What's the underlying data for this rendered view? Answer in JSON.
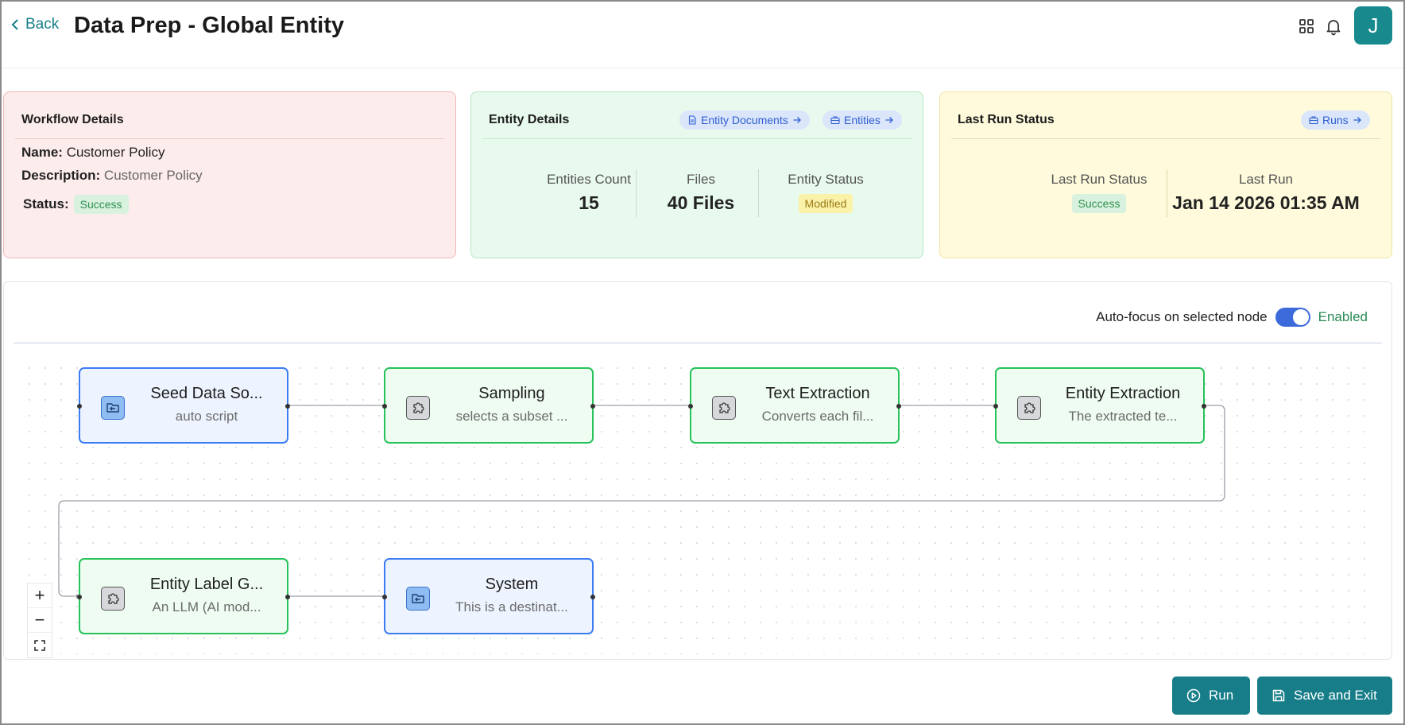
{
  "header": {
    "back_label": "Back",
    "title": "Data Prep - Global Entity",
    "avatar_initial": "J"
  },
  "workflow_details": {
    "title": "Workflow Details",
    "name_label": "Name:",
    "name_value": "Customer Policy",
    "description_label": "Description:",
    "description_value": "Customer Policy",
    "status_label": "Status:",
    "status_value": "Success"
  },
  "entity_details": {
    "title": "Entity Details",
    "documents_chip": "Entity Documents",
    "entities_chip": "Entities",
    "entities_count_label": "Entities Count",
    "entities_count_value": "15",
    "files_label": "Files",
    "files_value": "40 Files",
    "entity_status_label": "Entity Status",
    "entity_status_value": "Modified"
  },
  "last_run": {
    "title": "Last Run Status",
    "runs_chip": "Runs",
    "status_label": "Last Run Status",
    "status_value": "Success",
    "last_run_label": "Last Run",
    "last_run_value": "Jan 14 2026 01:35 AM"
  },
  "canvas": {
    "autofocus_label": "Auto-focus on selected node",
    "autofocus_state": "Enabled",
    "nodes": [
      {
        "title": "Seed Data So...",
        "desc": "auto script",
        "kind": "data-source"
      },
      {
        "title": "Sampling",
        "desc": "selects a subset ...",
        "kind": "plugin"
      },
      {
        "title": "Text Extraction",
        "desc": "Converts each fil...",
        "kind": "plugin"
      },
      {
        "title": "Entity Extraction",
        "desc": "The extracted te...",
        "kind": "plugin"
      },
      {
        "title": "Entity Label G...",
        "desc": "An LLM (AI mod...",
        "kind": "plugin"
      },
      {
        "title": "System",
        "desc": "This is a destinat...",
        "kind": "data-source"
      }
    ],
    "zoom_in": "+",
    "zoom_out": "−"
  },
  "footer": {
    "run_label": "Run",
    "save_exit_label": "Save and Exit"
  },
  "colors": {
    "accent": "#177e89",
    "toggle": "#3c6adb",
    "node_blue_border": "#3c7cf2",
    "node_green_border": "#27c25a"
  }
}
